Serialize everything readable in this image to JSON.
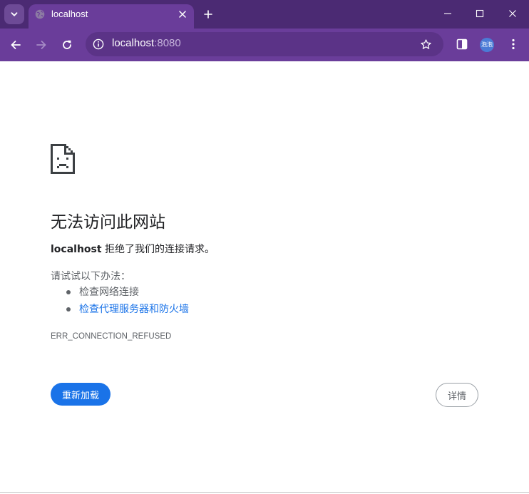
{
  "browser": {
    "tab": {
      "title": "localhost"
    },
    "omnibox": {
      "host": "localhost",
      "port": ":8080"
    },
    "profile": {
      "avatar_text": "泡泡"
    }
  },
  "error_page": {
    "title": "无法访问此网站",
    "host": "localhost",
    "message": " 拒绝了我们的连接请求。",
    "try_label": "请试试以下办法：",
    "suggestions": [
      {
        "text": "检查网络连接",
        "link": false
      },
      {
        "text": "检查代理服务器和防火墙",
        "link": true
      }
    ],
    "error_code": "ERR_CONNECTION_REFUSED",
    "reload_label": "重新加载",
    "details_label": "详情"
  },
  "colors": {
    "titlebar": "#4b2a73",
    "toolbar": "#6a3d9a",
    "omnibox": "#5b3387",
    "primary_button": "#1a73e8",
    "link": "#1a73e8"
  },
  "icons": {
    "tab_search": "chevron-down-icon",
    "favicon": "globe-icon",
    "tab_close": "close-icon",
    "new_tab": "plus-icon",
    "minimize": "minimize-icon",
    "maximize": "maximize-icon",
    "close_window": "close-icon",
    "back": "back-arrow-icon",
    "forward": "forward-arrow-icon",
    "reload": "reload-icon",
    "site_info": "info-icon",
    "bookmark": "star-icon",
    "side_panel": "side-panel-icon",
    "menu": "kebab-menu-icon",
    "error": "sad-document-icon"
  }
}
